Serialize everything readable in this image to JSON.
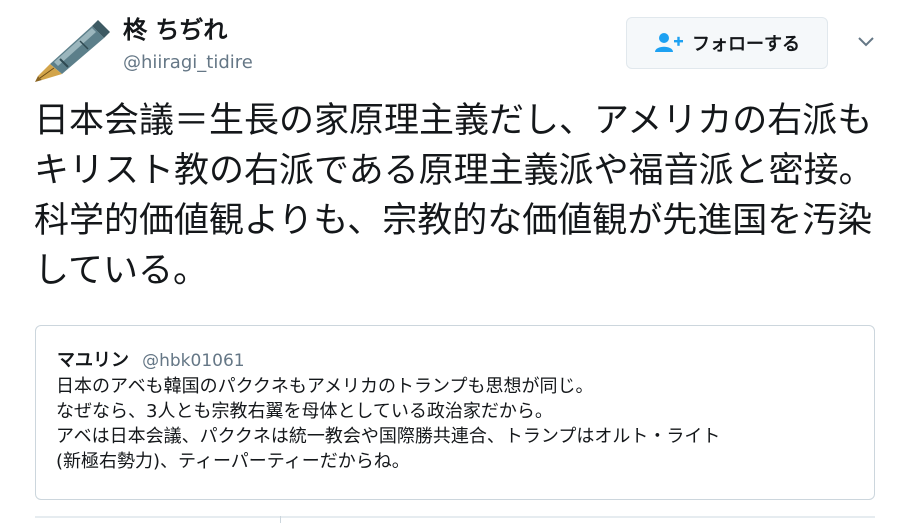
{
  "author": {
    "display_name": "柊 ちぢれ",
    "username": "@hiiragi_tidire"
  },
  "follow_button": {
    "label": "フォローする"
  },
  "tweet": {
    "text": "日本会議＝生長の家原理主義だし、アメリカの右派もキリスト教の右派である原理主義派や福音派と密接。科学的価値観よりも、宗教的な価値観が先進国を汚染している。"
  },
  "quoted_tweet": {
    "display_name": "マユリン",
    "username": "@hbk01061",
    "lines": [
      "日本のアベも韓国のパククネもアメリカのトランプも思想が同じ。",
      "なぜなら、3人とも宗教右翼を母体としている政治家だから。",
      "アベは日本会議、パククネは統一教会や国際勝共連合、トランプはオルト・ライト",
      "(新極右勢力)、ティーパーティーだからね。"
    ]
  },
  "icons": {
    "avatar": "fountain-pen-avatar",
    "follow": "add-user-icon",
    "menu": "chevron-down-icon"
  },
  "colors": {
    "text": "#14171a",
    "secondary_text": "#657786",
    "border": "#e1e8ed",
    "follow_icon": "#1da1f2"
  }
}
